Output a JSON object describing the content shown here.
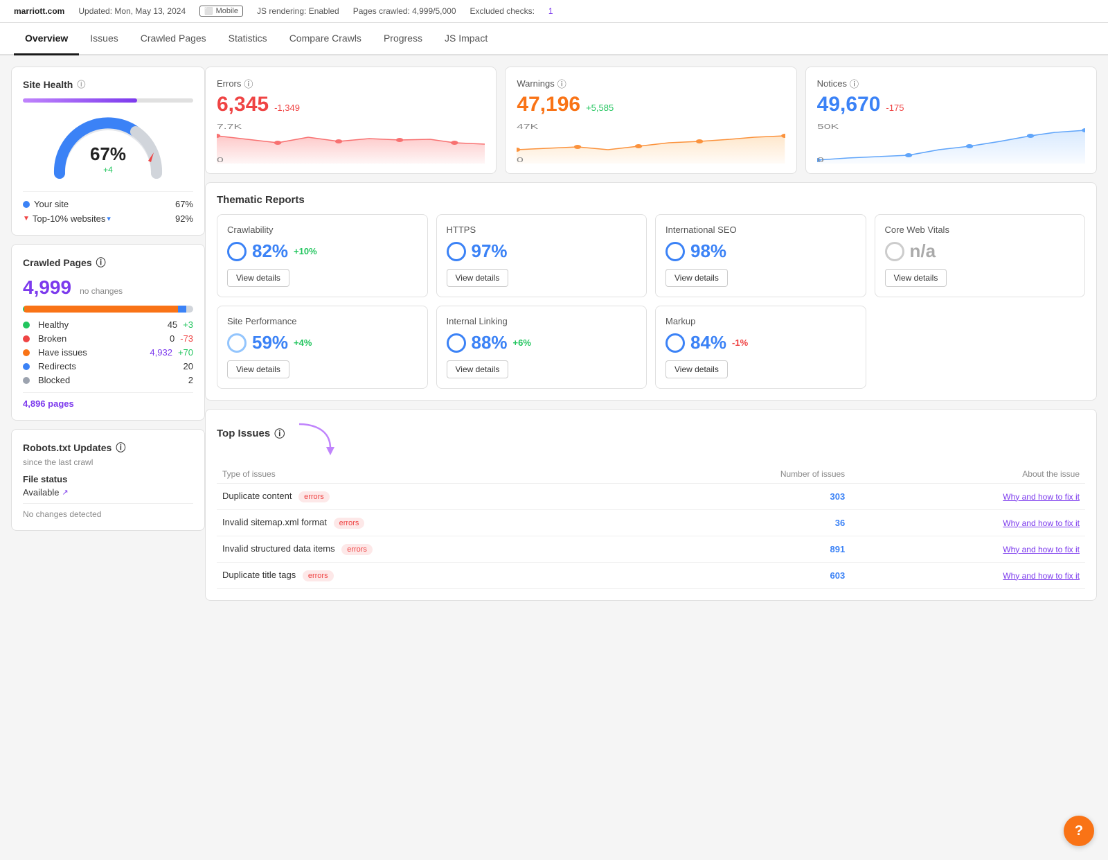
{
  "topbar": {
    "site": "marriott.com",
    "updated_label": "Updated: Mon, May 13, 2024",
    "device": "Mobile",
    "js_rendering": "JS rendering: Enabled",
    "pages_crawled": "Pages crawled: 4,999/5,000",
    "excluded_label": "Excluded checks:",
    "excluded_count": "1"
  },
  "nav": {
    "items": [
      "Overview",
      "Issues",
      "Crawled Pages",
      "Statistics",
      "Compare Crawls",
      "Progress",
      "JS Impact"
    ],
    "active": "Overview"
  },
  "sidebar": {
    "site_health": {
      "title": "Site Health",
      "percent": "67%",
      "change": "+4",
      "legend": [
        {
          "label": "Your site",
          "value": "67%",
          "color": "#3b82f6",
          "type": "dot"
        },
        {
          "label": "Top-10% websites",
          "value": "92%",
          "color": "#ef4444",
          "type": "triangle"
        }
      ]
    },
    "crawled_pages": {
      "title": "Crawled Pages",
      "count": "4,999",
      "change_label": "no changes",
      "stats": [
        {
          "label": "Healthy",
          "color": "#22c55e",
          "value": "45",
          "change": "+3"
        },
        {
          "label": "Broken",
          "color": "#ef4444",
          "value": "0",
          "change": "-73"
        },
        {
          "label": "Have issues",
          "color": "#f97316",
          "value": "4,932",
          "change": "+70"
        },
        {
          "label": "Redirects",
          "color": "#3b82f6",
          "value": "20",
          "change": ""
        },
        {
          "label": "Blocked",
          "color": "#9ca3af",
          "value": "2",
          "change": ""
        }
      ],
      "pages_link": "4,896 pages"
    },
    "robots": {
      "title": "Robots.txt Updates",
      "subtitle": "since the last crawl",
      "file_status_label": "File status",
      "file_status_value": "Available",
      "no_changes": "No changes detected"
    }
  },
  "metrics": {
    "errors": {
      "label": "Errors",
      "value": "6,345",
      "change": "-1,349",
      "change_type": "neg",
      "y_top": "7.7K",
      "y_bot": "0"
    },
    "warnings": {
      "label": "Warnings",
      "value": "47,196",
      "change": "+5,585",
      "change_type": "pos",
      "y_top": "47K",
      "y_bot": "0"
    },
    "notices": {
      "label": "Notices",
      "value": "49,670",
      "change": "-175",
      "change_type": "neg",
      "y_top": "50K",
      "y_bot": "0"
    }
  },
  "thematic_reports": {
    "title": "Thematic Reports",
    "row1": [
      {
        "name": "Crawlability",
        "score": "82%",
        "change": "+10%",
        "change_type": "pos"
      },
      {
        "name": "HTTPS",
        "score": "97%",
        "change": "",
        "change_type": ""
      },
      {
        "name": "International SEO",
        "score": "98%",
        "change": "",
        "change_type": ""
      },
      {
        "name": "Core Web Vitals",
        "score": "n/a",
        "change": "",
        "change_type": "",
        "na": true
      }
    ],
    "row2": [
      {
        "name": "Site Performance",
        "score": "59%",
        "change": "+4%",
        "change_type": "pos"
      },
      {
        "name": "Internal Linking",
        "score": "88%",
        "change": "+6%",
        "change_type": "pos"
      },
      {
        "name": "Markup",
        "score": "84%",
        "change": "-1%",
        "change_type": "neg"
      },
      {
        "name": "",
        "score": "",
        "change": "",
        "change_type": "",
        "empty": true
      }
    ],
    "view_details_label": "View details"
  },
  "top_issues": {
    "title": "Top Issues",
    "columns": [
      "Type of issues",
      "Number of issues",
      "About the issue"
    ],
    "rows": [
      {
        "issue": "Duplicate content",
        "badge": "errors",
        "count": "303",
        "link": "Why and how to fix it"
      },
      {
        "issue": "Invalid sitemap.xml format",
        "badge": "errors",
        "count": "36",
        "link": "Why and how to fix it"
      },
      {
        "issue": "Invalid structured data items",
        "badge": "errors",
        "count": "891",
        "link": "Why and how to fix it"
      },
      {
        "issue": "Duplicate title tags",
        "badge": "errors",
        "count": "603",
        "link": "Why and how to fix it"
      }
    ]
  },
  "help_btn": "?"
}
